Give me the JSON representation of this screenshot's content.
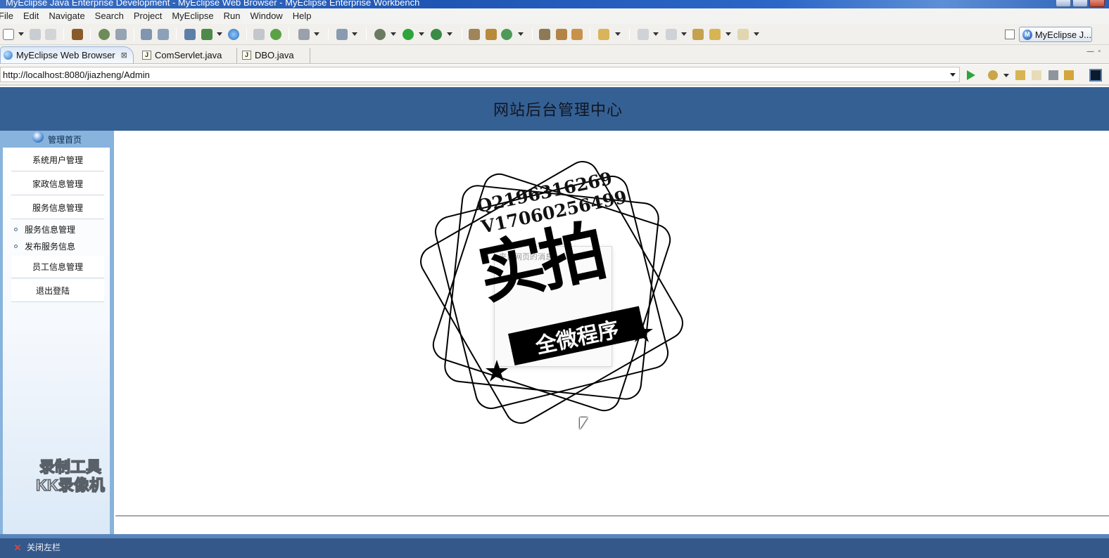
{
  "window": {
    "title": "MyEclipse Java Enterprise Development - MyEclipse Web Browser - MyEclipse Enterprise Workbench"
  },
  "menubar": {
    "items": [
      "File",
      "Edit",
      "Navigate",
      "Search",
      "Project",
      "MyEclipse",
      "Run",
      "Window",
      "Help"
    ]
  },
  "toolbar": {
    "perspective_label": "MyEclipse J..."
  },
  "tabs": [
    {
      "label": "MyEclipse Web Browser",
      "active": true,
      "close": "⊠"
    },
    {
      "label": "ComServlet.java",
      "active": false
    },
    {
      "label": "DBO.java",
      "active": false
    }
  ],
  "address": {
    "url": "http://localhost:8080/jiazheng/Admin"
  },
  "page": {
    "title": "网站后台管理中心"
  },
  "sidebar": {
    "home_label": "管理首页",
    "sections": [
      "系统用户管理",
      "家政信息管理",
      "服务信息管理"
    ],
    "sub_items": [
      "服务信息管理",
      "发布服务信息"
    ],
    "sections_after": [
      "员工信息管理",
      "退出登陆"
    ]
  },
  "overlay": {
    "stamp_lines": [
      "Q2196316269",
      "V17060256499"
    ],
    "stamp_main": "实拍",
    "stamp_ribbon": "全微程序",
    "ghost_dialog_title": "来自网页的消息",
    "recorder_watermark": [
      "录制工具",
      "KK录像机"
    ]
  },
  "bottombar": {
    "close_left_label": "关闭左栏"
  },
  "colors": {
    "header_bg": "#356094",
    "sidebar_frame": "#88b3dc",
    "bottombar_bg": "#35588a"
  }
}
